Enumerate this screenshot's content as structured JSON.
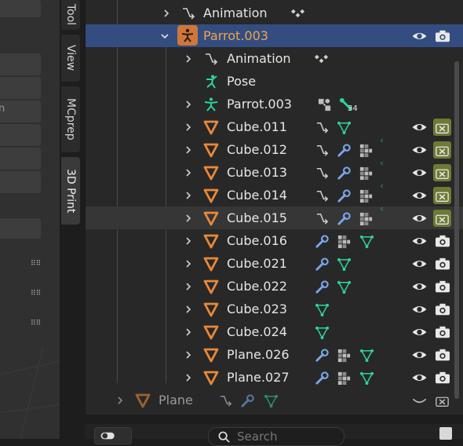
{
  "tabs": [
    {
      "label": "Tool",
      "active": false
    },
    {
      "label": "View",
      "active": false
    },
    {
      "label": "MCprep",
      "active": false
    },
    {
      "label": "3D Print",
      "active": true
    }
  ],
  "left_panel": {
    "partial_text": "n"
  },
  "outliner": {
    "rows": [
      {
        "label": "Animation",
        "icon": "animation-icon",
        "state": "normal"
      },
      {
        "label": "Parrot.003",
        "icon": "armature-object-icon",
        "state": "selected"
      },
      {
        "label": "Animation",
        "icon": "animation-icon",
        "state": "normal"
      },
      {
        "label": "Pose",
        "icon": "pose-icon",
        "state": "normal"
      },
      {
        "label": "Parrot.003",
        "icon": "armature-data-icon",
        "state": "normal",
        "bone_count": "34"
      },
      {
        "label": "Cube.011",
        "icon": "mesh-object-icon",
        "state": "normal",
        "render": "disabled"
      },
      {
        "label": "Cube.012",
        "icon": "mesh-object-icon",
        "state": "normal",
        "render": "disabled"
      },
      {
        "label": "Cube.013",
        "icon": "mesh-object-icon",
        "state": "normal",
        "render": "disabled"
      },
      {
        "label": "Cube.014",
        "icon": "mesh-object-icon",
        "state": "normal",
        "render": "disabled"
      },
      {
        "label": "Cube.015",
        "icon": "mesh-object-icon",
        "state": "hovered",
        "render": "disabled"
      },
      {
        "label": "Cube.016",
        "icon": "mesh-object-icon",
        "state": "normal",
        "render": "enabled"
      },
      {
        "label": "Cube.021",
        "icon": "mesh-object-icon",
        "state": "normal",
        "render": "enabled"
      },
      {
        "label": "Cube.022",
        "icon": "mesh-object-icon",
        "state": "normal",
        "render": "enabled"
      },
      {
        "label": "Cube.023",
        "icon": "mesh-object-icon",
        "state": "normal",
        "render": "enabled"
      },
      {
        "label": "Cube.024",
        "icon": "mesh-object-icon",
        "state": "normal",
        "render": "enabled"
      },
      {
        "label": "Plane.026",
        "icon": "mesh-object-icon",
        "state": "normal",
        "render": "enabled"
      },
      {
        "label": "Plane.027",
        "icon": "mesh-object-icon",
        "state": "normal",
        "render": "enabled"
      },
      {
        "label": "Plane",
        "icon": "mesh-object-icon",
        "state": "dimmed",
        "render": "disabled"
      }
    ]
  },
  "search": {
    "placeholder": "Search"
  },
  "colors": {
    "selected_row": "#334d80",
    "mesh_orange": "#e8893a",
    "armature_orange": "#e8893a",
    "data_green": "#2ed3a0",
    "modifier_blue": "#7aa7e8",
    "disabled_render_bg": "#6d7a35"
  }
}
